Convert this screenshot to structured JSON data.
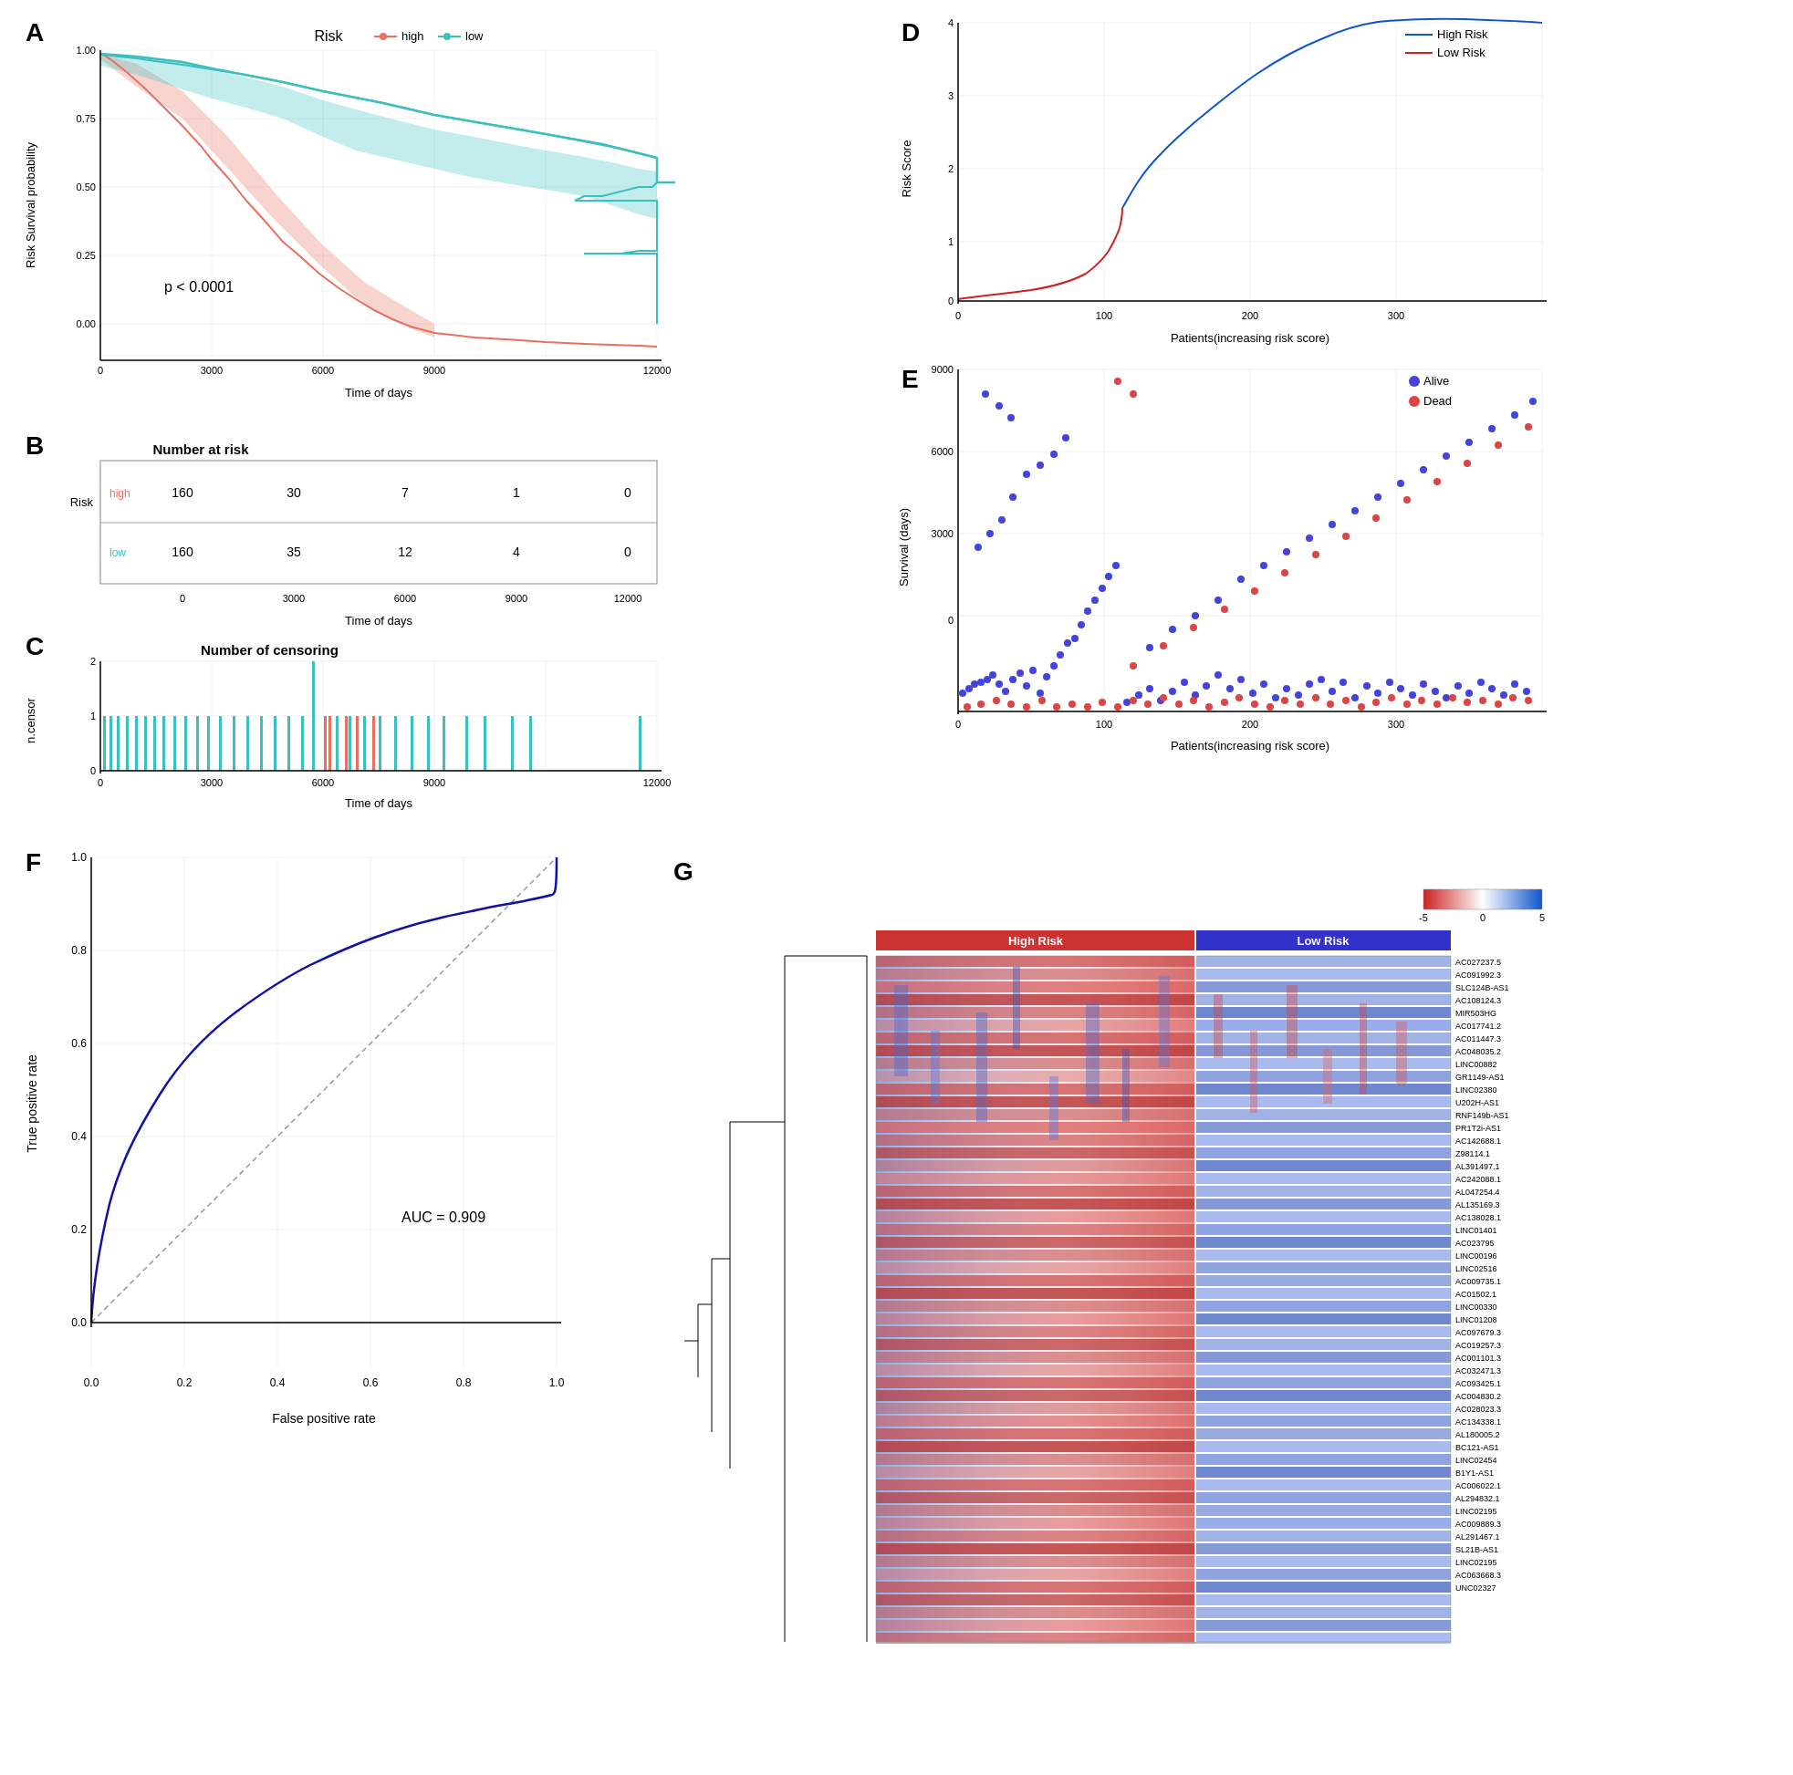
{
  "panels": {
    "a": {
      "label": "A",
      "title": "Risk",
      "legend_high": "high",
      "legend_low": "low",
      "x_label": "Time of days",
      "y_label": "Risk Survival probability",
      "p_value": "p < 0.0001"
    },
    "b": {
      "label": "B",
      "title": "Number at risk",
      "x_label": "Time of days",
      "y_label": "Risk",
      "high_label": "high",
      "low_label": "low",
      "high_values": [
        "160",
        "30",
        "7",
        "1",
        "0"
      ],
      "low_values": [
        "160",
        "35",
        "12",
        "4",
        "0"
      ],
      "x_ticks": [
        "0",
        "3000",
        "6000",
        "9000",
        "12000"
      ]
    },
    "c": {
      "label": "C",
      "title": "Number of censoring",
      "x_label": "Time of days",
      "y_label": "n.censor",
      "y_ticks": [
        "0",
        "1",
        "2"
      ],
      "x_ticks": [
        "0",
        "3000",
        "6000",
        "9000",
        "12000"
      ]
    },
    "d": {
      "label": "D",
      "x_label": "Patients(increasing risk score)",
      "y_label": "Risk Score",
      "legend_high": "High Risk",
      "legend_low": "Low Risk"
    },
    "e": {
      "label": "E",
      "x_label": "Patients(increasing risk score)",
      "y_label": "Survival (days)",
      "legend_alive": "Alive",
      "legend_dead": "Dead"
    },
    "f": {
      "label": "F",
      "x_label": "False positive rate",
      "y_label": "True positive rate",
      "auc_text": "AUC = 0.909"
    },
    "g": {
      "label": "G",
      "high_risk_label": "High Risk",
      "low_risk_label": "Low Risk",
      "color_scale_min": "-5",
      "color_scale_zero": "0",
      "color_scale_max": "5",
      "genes": [
        "AC027237.5",
        "AC091992.3",
        "SLC124B-AS1",
        "AC108124.3",
        "MIR503HG",
        "AC017741.2",
        "AC011447.3",
        "AC048035.2",
        "LINC00882",
        "GR1149-AS1",
        "LINC02380",
        "U202H-AS1",
        "RNF149b-AS1",
        "PR1T2i-AS1",
        "AC142688.1",
        "Z98114.1",
        "AL391497.1",
        "AC242088.1",
        "AL047254.4",
        "AL135169.3",
        "AC138028.1",
        "LINC01401",
        "AC023795",
        "LINC00196",
        "LINC02516",
        "AC009735.1",
        "AC01502.1",
        "LINC00330",
        "LINC01208",
        "AC097679.3",
        "AC019257.3",
        "AC001101.3",
        "AC032471.3",
        "AC093425.1",
        "AC004830.2",
        "AC028023.3",
        "AC134338.1",
        "AL180005.2",
        "BC121-AS1",
        "LINC02454",
        "B1Y1-AS1",
        "AC006022.1",
        "AL294832.1",
        "LINC02195",
        "AC009889.3",
        "AL291467.1",
        "SL21B-AS1",
        "LINC02195",
        "AC063668.3",
        "UNC02327"
      ]
    }
  },
  "colors": {
    "high_risk": "#E87060",
    "low_risk": "#3BBFBF",
    "high_risk_bar": "#CC3333",
    "low_risk_bar": "#3333CC",
    "alive_dot": "#4444DD",
    "dead_dot": "#DD4444",
    "roc_line": "#1111AA",
    "diagonal": "#999999"
  }
}
